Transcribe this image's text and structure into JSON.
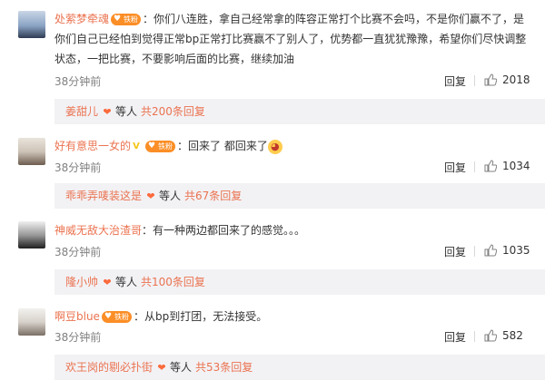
{
  "colors": {
    "accent": "#eb7350",
    "fan_badge": "#fb8e26",
    "reply_bg": "#f2f2f5",
    "meta": "#808080"
  },
  "comments": [
    {
      "user": "处萦梦牵魂",
      "badge": "铁粉",
      "text": "你们八连胜，拿自己经常拿的阵容正常打个比赛不会吗，不是你们赢不了，是你们自己已经怕到觉得正常bp正常打比赛赢不了别人了，优势都一直犹犹豫豫，希望你们尽快调整状态，一把比赛，不要影响后面的比赛，继续加油",
      "time": "38分钟前",
      "reply_label": "回复",
      "likes": "2018",
      "sub": {
        "user": "姜甜儿",
        "others": "等人",
        "count": "共200条回复"
      }
    },
    {
      "user": "好有意思一女的",
      "verified": "V",
      "badge": "铁粉",
      "text": "回来了 都回来了",
      "emoji": "blush-emoji",
      "time": "38分钟前",
      "reply_label": "回复",
      "likes": "1034",
      "sub": {
        "user": "乖乖弄唛装这是",
        "others": "等人",
        "count": "共67条回复"
      }
    },
    {
      "user": "神威无敌大治渣哥",
      "text": "有一种两边都回来了的感觉。。。",
      "time": "38分钟前",
      "reply_label": "回复",
      "likes": "1035",
      "sub": {
        "user": "隆小帅",
        "others": "等人",
        "count": "共100条回复"
      }
    },
    {
      "user": "啊豆blue",
      "badge": "铁粉",
      "text": "从bp到打团，无法接受。",
      "time": "38分钟前",
      "reply_label": "回复",
      "likes": "582",
      "sub": {
        "user": "欢王岗的剔必扑街",
        "others": "等人",
        "count": "共53条回复"
      }
    }
  ]
}
